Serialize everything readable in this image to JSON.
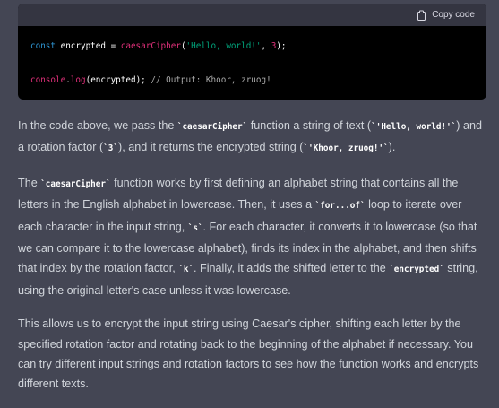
{
  "code_block": {
    "copy_label": "Copy code",
    "lines": [
      {
        "tokens": [
          {
            "t": "const",
            "c": "kw"
          },
          {
            "t": " encrypted = ",
            "c": "plain"
          },
          {
            "t": "caesarCipher",
            "c": "fn"
          },
          {
            "t": "(",
            "c": "plain"
          },
          {
            "t": "'Hello, world!'",
            "c": "str"
          },
          {
            "t": ", ",
            "c": "plain"
          },
          {
            "t": "3",
            "c": "num"
          },
          {
            "t": ");",
            "c": "plain"
          }
        ]
      },
      {
        "tokens": []
      },
      {
        "tokens": [
          {
            "t": "console",
            "c": "fn"
          },
          {
            "t": ".",
            "c": "plain"
          },
          {
            "t": "log",
            "c": "fn"
          },
          {
            "t": "(encrypted); ",
            "c": "plain"
          },
          {
            "t": "// Output: Khoor, zruog!",
            "c": "cm"
          }
        ]
      }
    ]
  },
  "paragraphs": [
    [
      {
        "text": "In the code above, we pass the "
      },
      {
        "code": "`caesarCipher`"
      },
      {
        "text": " function a string of text ("
      },
      {
        "code": "`'Hello, world!'`"
      },
      {
        "text": ") and a rotation factor ("
      },
      {
        "code": "`3`"
      },
      {
        "text": "), and it returns the encrypted string ("
      },
      {
        "code": "`'Khoor, zruog!'`"
      },
      {
        "text": ")."
      }
    ],
    [
      {
        "text": "The "
      },
      {
        "code": "`caesarCipher`"
      },
      {
        "text": " function works by first defining an alphabet string that contains all the letters in the English alphabet in lowercase. Then, it uses a "
      },
      {
        "code": "`for...of`"
      },
      {
        "text": " loop to iterate over each character in the input string, "
      },
      {
        "code": "`s`"
      },
      {
        "text": ". For each character, it converts it to lowercase (so that we can compare it to the lowercase alphabet), finds its index in the alphabet, and then shifts that index by the rotation factor, "
      },
      {
        "code": "`k`"
      },
      {
        "text": ". Finally, it adds the shifted letter to the "
      },
      {
        "code": "`encrypted`"
      },
      {
        "text": " string, using the original letter's case unless it was lowercase."
      }
    ],
    [
      {
        "text": "This allows us to encrypt the input string using Caesar's cipher, shifting each letter by the specified rotation factor and rotating back to the beginning of the alphabet if necessary. You can try different input strings and rotation factors to see how the function works and encrypts different texts."
      }
    ]
  ]
}
